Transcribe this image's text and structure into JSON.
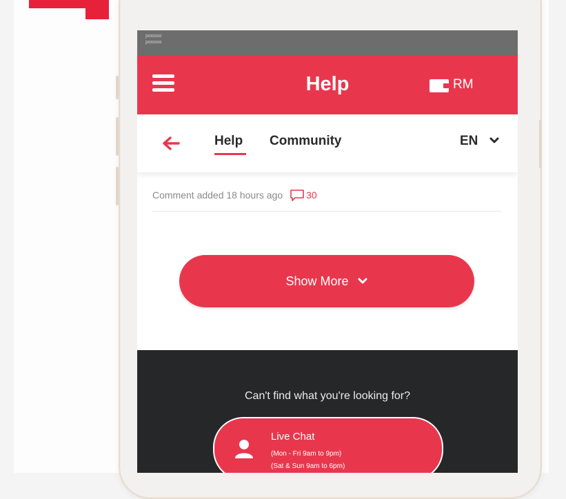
{
  "status_bar": {
    "carrier_top": "pooooo",
    "carrier_bottom": "pooooo"
  },
  "app_bar": {
    "title": "Help",
    "wallet_label": "RM"
  },
  "tabs": [
    {
      "label": "Help",
      "active": true
    },
    {
      "label": "Community",
      "active": false
    }
  ],
  "language": {
    "selected": "EN"
  },
  "comment": {
    "text": "Comment added 18 hours ago",
    "count": "30"
  },
  "show_more": {
    "label": "Show More"
  },
  "footer": {
    "question": "Can't find what you're looking for?",
    "live_chat": {
      "title": "Live Chat",
      "hours_weekday": "(Mon - Fri 9am to 9pm)",
      "hours_weekend": "(Sat & Sun 9am to 6pm)"
    }
  },
  "colors": {
    "accent": "#e8374d",
    "footer_bg": "#262729",
    "status_bar_bg": "#6d6d6d"
  },
  "icons": [
    "menu-icon",
    "wallet-icon",
    "back-arrow-icon",
    "chevron-down-icon",
    "comment-icon",
    "user-icon"
  ]
}
